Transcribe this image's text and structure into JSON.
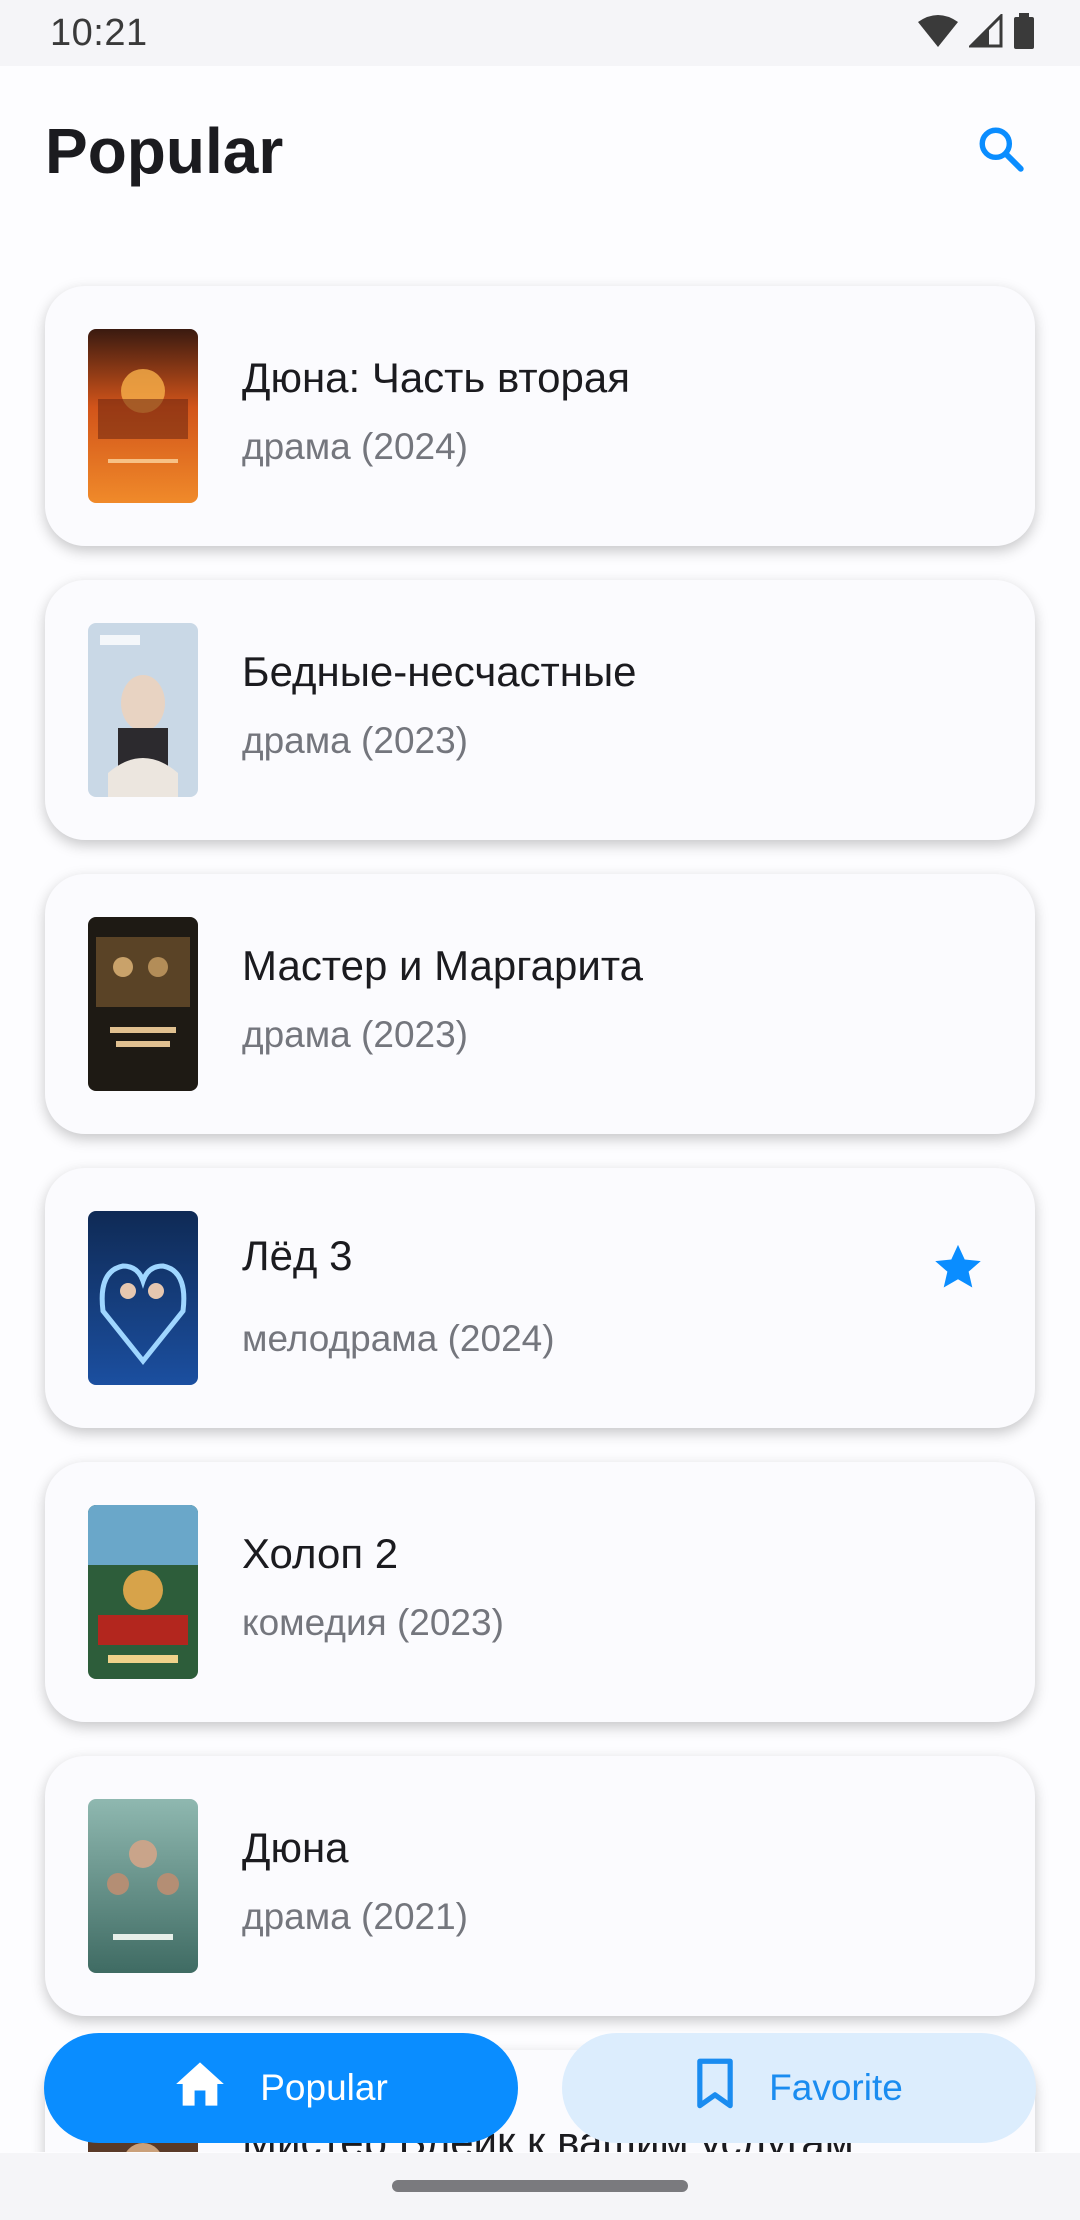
{
  "status_bar": {
    "time": "10:21",
    "icons": [
      "wifi-icon",
      "cell-signal-icon",
      "battery-icon"
    ]
  },
  "header": {
    "title": "Popular",
    "search_icon": "search-icon"
  },
  "colors": {
    "accent": "#0a8dff",
    "accent_soft": "#dcedfd",
    "title_text": "#1b1b1f",
    "meta_text": "#74767d"
  },
  "movies": [
    {
      "title": "Дюна: Часть вторая",
      "meta": "драма (2024)",
      "favorite": false
    },
    {
      "title": "Бедные-несчастные",
      "meta": "драма (2023)",
      "favorite": false
    },
    {
      "title": "Мастер и Маргарита",
      "meta": "драма (2023)",
      "favorite": false
    },
    {
      "title": "Лёд 3",
      "meta": "мелодрама (2024)",
      "favorite": true
    },
    {
      "title": "Холоп 2",
      "meta": "комедия (2023)",
      "favorite": false
    },
    {
      "title": "Дюна",
      "meta": "драма (2021)",
      "favorite": false
    },
    {
      "title": "Мистер Блейк к вашим услугам"
    }
  ],
  "bottom_nav": {
    "popular_label": "Popular",
    "popular_icon": "home-icon",
    "favorite_label": "Favorite",
    "favorite_icon": "bookmark-icon",
    "active": "Popular"
  }
}
